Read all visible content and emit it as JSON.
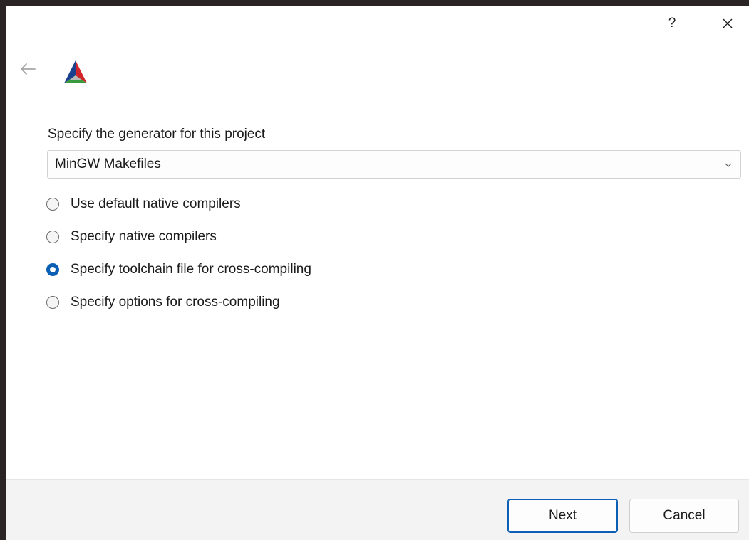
{
  "titlebar": {
    "help_label": "?",
    "icons": {
      "help": "question-mark",
      "close": "close-x",
      "back": "arrow-left"
    }
  },
  "app": {
    "logo": "cmake-logo-triangle"
  },
  "generator": {
    "prompt": "Specify the generator for this project",
    "selected": "MinGW Makefiles"
  },
  "options": [
    {
      "label": "Use default native compilers",
      "checked": false
    },
    {
      "label": "Specify native compilers",
      "checked": false
    },
    {
      "label": "Specify toolchain file for cross-compiling",
      "checked": true
    },
    {
      "label": "Specify options for cross-compiling",
      "checked": false
    }
  ],
  "footer": {
    "next_label": "Next",
    "cancel_label": "Cancel"
  },
  "colors": {
    "accent": "#0a5fb4",
    "logo_red": "#d2232a",
    "logo_green": "#3a9a3e",
    "logo_blue": "#1b3f8f"
  }
}
